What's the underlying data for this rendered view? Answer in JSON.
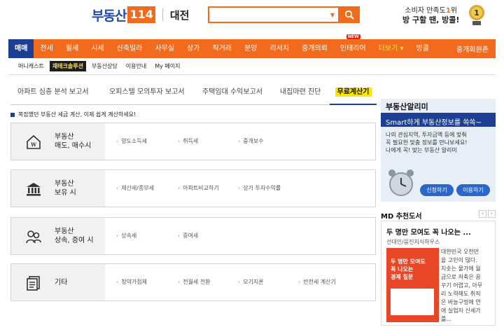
{
  "header": {
    "logo_text": "부동산",
    "logo_box": "114",
    "region": "대전",
    "promo_line1_pre": "소비자 만족도",
    "promo_line1_num": "1",
    "promo_line1_post": "위",
    "promo_line2": "방 구할 땐, 방콜!"
  },
  "main_nav": {
    "items": [
      "매매",
      "전세",
      "월세",
      "시세",
      "신축빌라",
      "사무실",
      "상가",
      "직거래",
      "분양",
      "리서치",
      "중개의뢰",
      "인테리어",
      "더보기 ▾",
      "방콜"
    ],
    "new_badge": "NEW",
    "right": "중개회원존"
  },
  "sub_nav": {
    "items": [
      "머니캐스트",
      "재테크솔루션",
      "부동산상담",
      "이용안내",
      "My 페이지"
    ]
  },
  "tabs": [
    "아파트 심층 분석 보고서",
    "오피스텔 모의투자 보고서",
    "주택임대 수익보고서",
    "내집마련 진단",
    "무료계산기"
  ],
  "notice": "복잡했던 부동산 세금 계산, 이제 쉽게 계산하세요!",
  "cards": [
    {
      "title1": "부동산",
      "title2": "매도, 매수시",
      "links": [
        "양도소득세",
        "취득세",
        "중개보수"
      ]
    },
    {
      "title1": "부동산",
      "title2": "보유 시",
      "links": [
        "재산세/종부세",
        "아파트비교하기",
        "상가 투자수익률"
      ]
    },
    {
      "title1": "부동산",
      "title2": "상속, 증여 시",
      "links": [
        "상속세",
        "증여세"
      ]
    },
    {
      "title1": "기타",
      "title2": "",
      "links": [
        "청약가점제",
        "전월세 전환",
        "모기지론",
        "반전세 계산기"
      ]
    }
  ],
  "alert": {
    "title": "부동산알리미",
    "subtitle": "Smart하게 부동산정보를 쏙쏙~",
    "desc1": "나의 관심지역, 투자금액 등에 맞춰",
    "desc2": "꼭 필요한 맞춤 정보를 만나보세요!",
    "desc3": "나에게 꼭! 맞는 부동산 알리미",
    "btn1": "신청하기",
    "btn2": "이용하기"
  },
  "md": {
    "section_title": "MD 추천도서",
    "book_title": "두 명만 모여도 꼭 나오는 ...",
    "author": "선대인/웅진지식하우스",
    "cover_text1": "두 명만 모여도",
    "cover_text2": "꼭 나오는",
    "cover_text3": "경제 질문",
    "desc": [
      "대한민국 오천만",
      "을 고민이 많다.",
      "치솟는 물가에 월",
      "급으로 저축은 꿈",
      "꾸기 어렵고, 아무",
      "리 노력해도 취직",
      "은 바늘구멍에 연",
      "애 실업자 신세가",
      "를..."
    ]
  },
  "colors": {
    "brand_orange": "#f26a1b",
    "brand_navy": "#1c3f95",
    "highlight_yellow": "#ffe600"
  }
}
